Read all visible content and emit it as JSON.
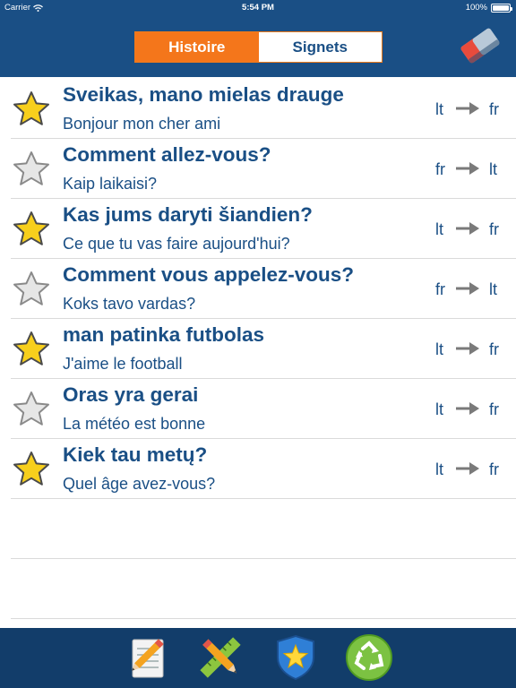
{
  "status": {
    "carrier": "Carrier",
    "time": "5:54 PM",
    "battery": "100%"
  },
  "segments": {
    "history": "Histoire",
    "bookmarks": "Signets",
    "active": "history"
  },
  "rows": [
    {
      "starred": true,
      "title": "Sveikas, mano mielas drauge",
      "subtitle": "Bonjour mon cher ami",
      "from": "lt",
      "to": "fr"
    },
    {
      "starred": false,
      "title": "Comment allez-vous?",
      "subtitle": "Kaip laikaisi?",
      "from": "fr",
      "to": "lt"
    },
    {
      "starred": true,
      "title": "Kas jums daryti šiandien?",
      "subtitle": "Ce que tu vas faire aujourd'hui?",
      "from": "lt",
      "to": "fr"
    },
    {
      "starred": false,
      "title": "Comment vous appelez-vous?",
      "subtitle": "Koks tavo vardas?",
      "from": "fr",
      "to": "lt"
    },
    {
      "starred": true,
      "title": "man patinka futbolas",
      "subtitle": "J'aime le football",
      "from": "lt",
      "to": "fr"
    },
    {
      "starred": false,
      "title": "Oras yra gerai",
      "subtitle": "La météo est bonne",
      "from": "lt",
      "to": "fr"
    },
    {
      "starred": true,
      "title": "Kiek tau metų?",
      "subtitle": "Quel âge avez-vous?",
      "from": "lt",
      "to": "fr"
    }
  ],
  "icons": {
    "clear": "eraser-icon",
    "tabs": [
      "notepad-pencil-icon",
      "ruler-pencil-icon",
      "star-shield-icon",
      "recycle-icon"
    ]
  },
  "colors": {
    "nav": "#1a4f85",
    "accent": "#f4761b",
    "text": "#1a4f85",
    "tabbar": "#123d6a"
  }
}
